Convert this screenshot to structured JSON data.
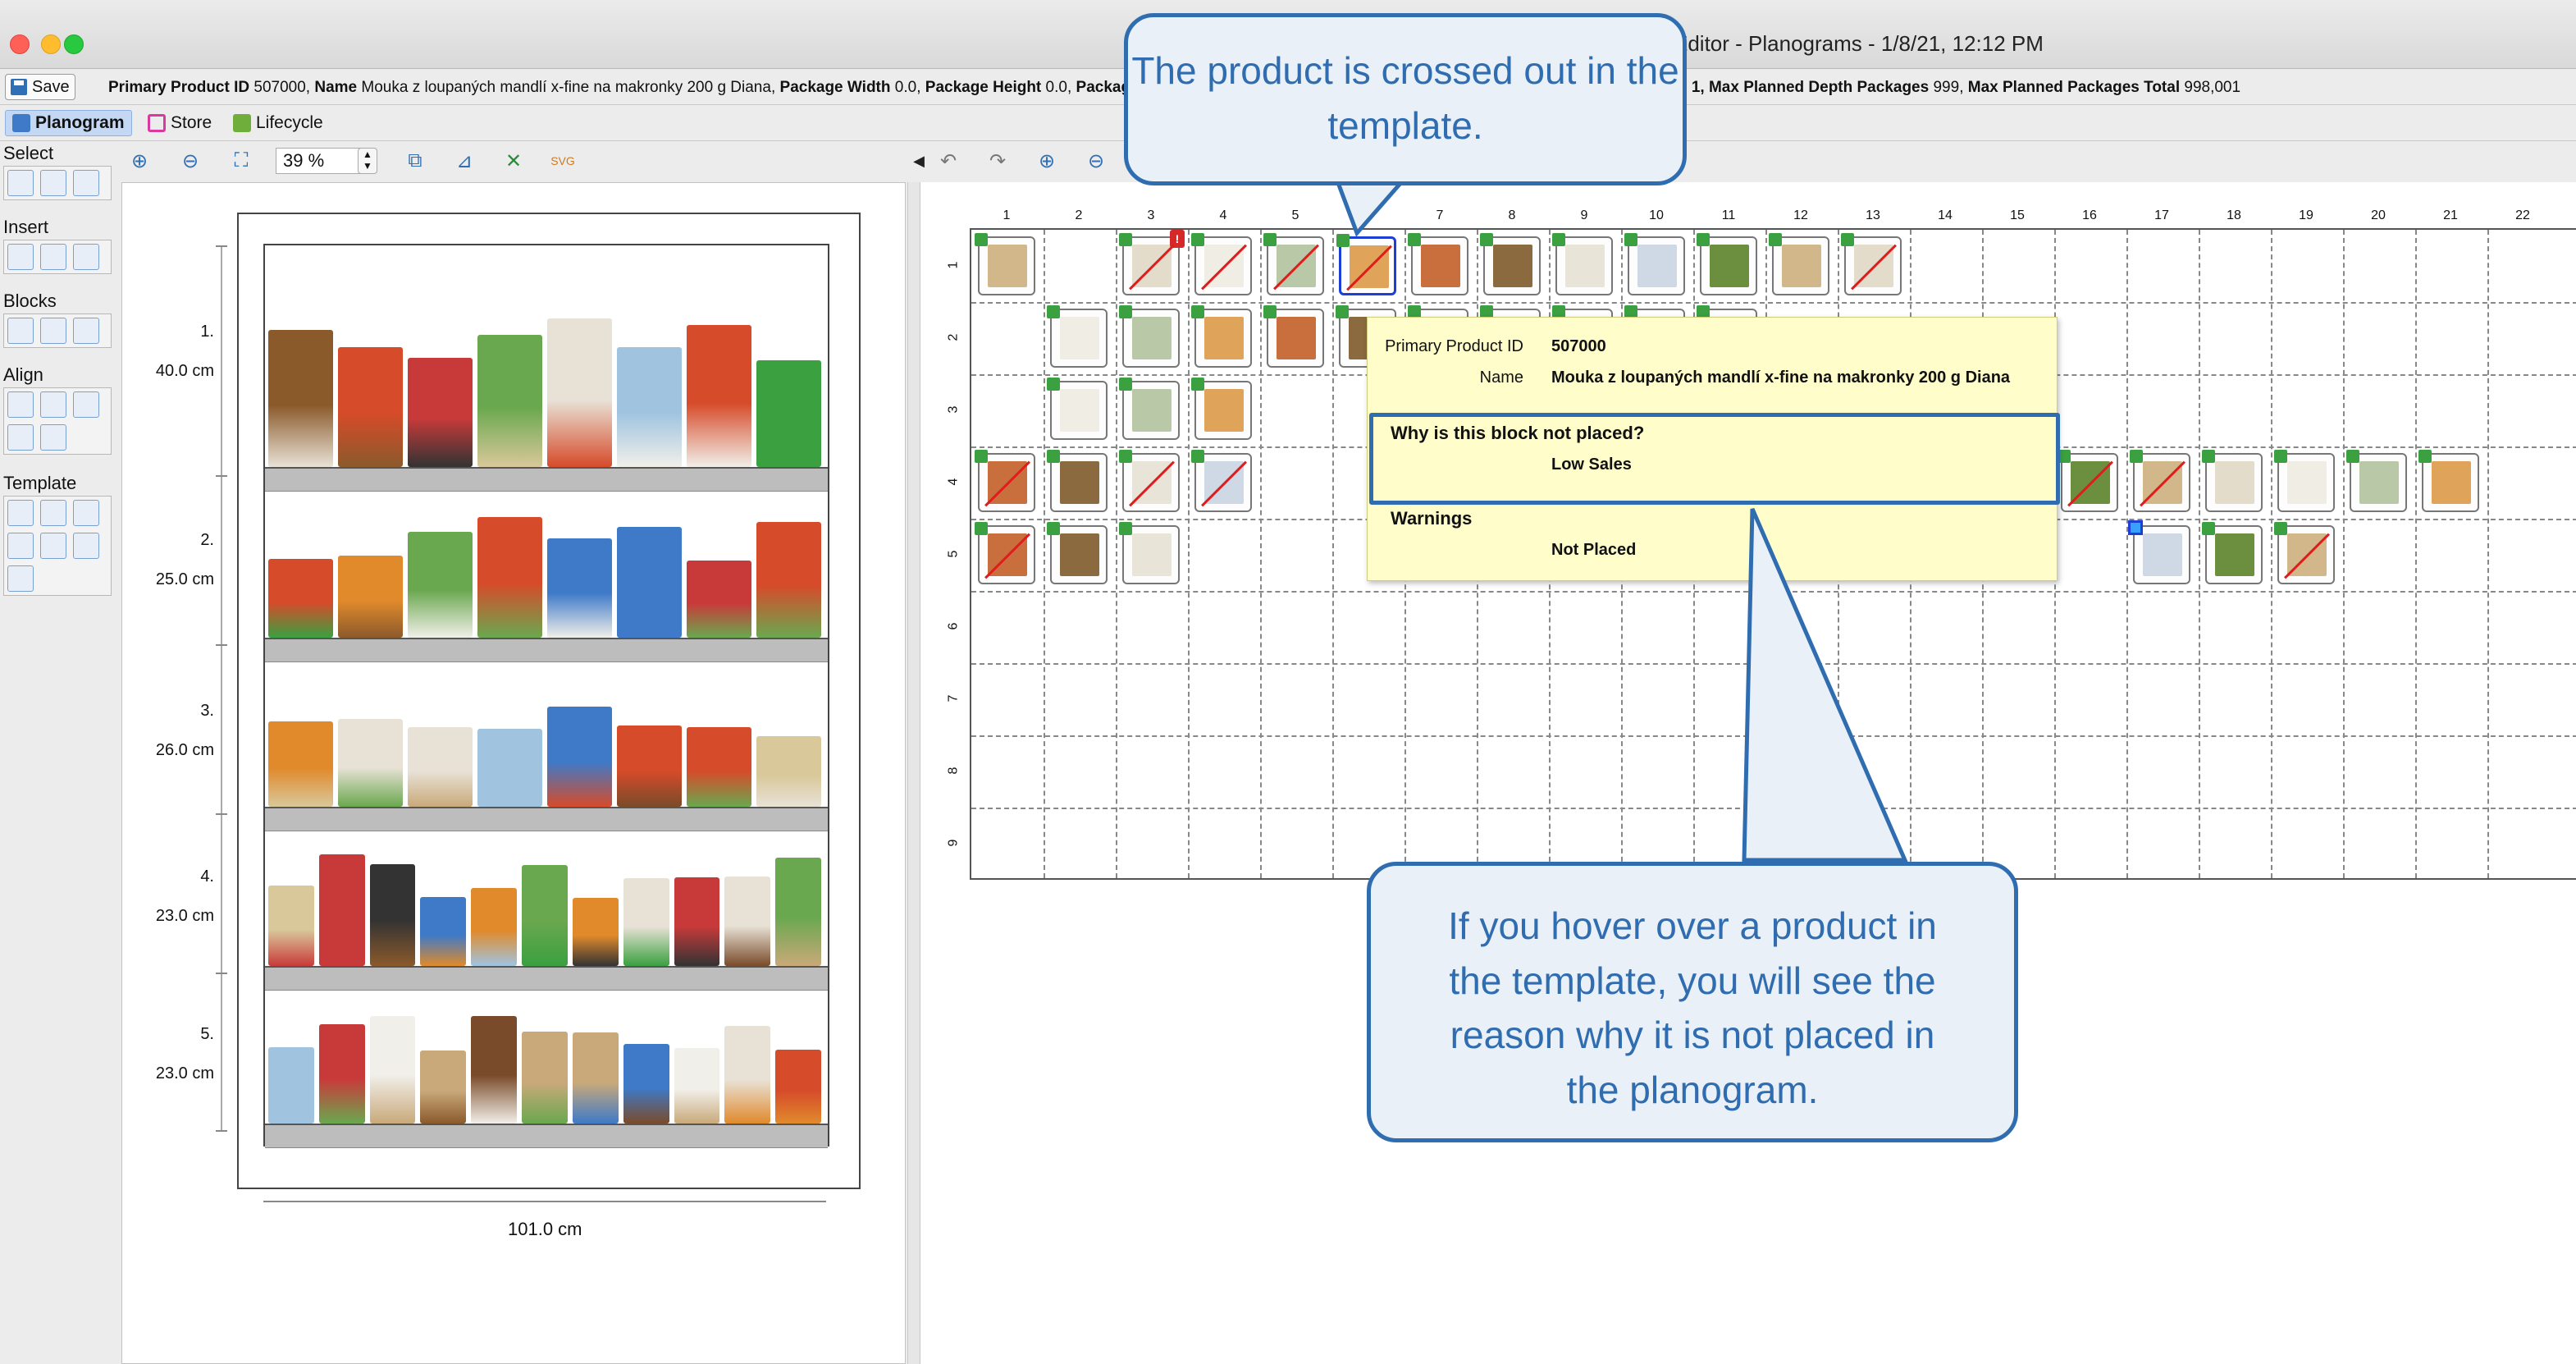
{
  "window": {
    "title": "Editor - Planograms - 1/8/21, 12:12 PM"
  },
  "infobar": {
    "save_label": "Save",
    "primary_id_key": "Primary Product ID",
    "primary_id_value": "507000",
    "name_key": "Name",
    "name_value": "Mouka z loupaných mandlí x-fine na makronky 200 g Diana",
    "pkg_width_key": "Package Width",
    "pkg_width_value": "0.0",
    "pkg_height_key": "Package Height",
    "pkg_height_value": "0.0",
    "pkg_trunc": "Packag",
    "right_prefix": "s 1,",
    "max_depth_key": "Max Planned Depth Packages",
    "max_depth_value": "999",
    "max_total_key": "Max Planned Packages Total",
    "max_total_value": "998,001"
  },
  "tabs": [
    {
      "label": "Planogram",
      "active": true
    },
    {
      "label": "Store",
      "active": false
    },
    {
      "label": "Lifecycle",
      "active": false
    }
  ],
  "toolbar": {
    "zoom_value": "39 %"
  },
  "palette": {
    "select": "Select",
    "insert": "Insert",
    "blocks": "Blocks",
    "align": "Align",
    "template": "Template"
  },
  "shelves": [
    {
      "index": "1.",
      "height": "40.0 cm"
    },
    {
      "index": "2.",
      "height": "25.0 cm"
    },
    {
      "index": "3.",
      "height": "26.0 cm"
    },
    {
      "index": "4.",
      "height": "23.0 cm"
    },
    {
      "index": "5.",
      "height": "23.0 cm"
    }
  ],
  "fixture_width": "101.0 cm",
  "grid": {
    "columns": [
      "1",
      "2",
      "3",
      "4",
      "5",
      "6",
      "7",
      "8",
      "9",
      "10",
      "11",
      "12",
      "13",
      "14",
      "15",
      "16",
      "17",
      "18",
      "19",
      "20",
      "21",
      "22"
    ],
    "rows": [
      "1",
      "2",
      "3",
      "4",
      "5",
      "6",
      "7",
      "8",
      "9"
    ]
  },
  "tooltip": {
    "primary_id_key": "Primary Product ID",
    "primary_id_value": "507000",
    "name_key": "Name",
    "name_value": "Mouka z loupaných mandlí x-fine na makronky 200 g Diana",
    "why_heading": "Why is this block not placed?",
    "why_value": "Low Sales",
    "warnings_heading": "Warnings",
    "warnings_value": "Not Placed"
  },
  "callouts": {
    "top": "The product is crossed out in the template.",
    "bottom": "If you hover over a product in the template, you will see the reason why it is not placed in the planogram."
  },
  "colors": {
    "callout_border": "#2f6db0",
    "callout_fill": "#e9f0f7",
    "tooltip_fill": "#fffdc9",
    "cross_out": "#e01c1c",
    "placed_marker": "#3aa040"
  }
}
